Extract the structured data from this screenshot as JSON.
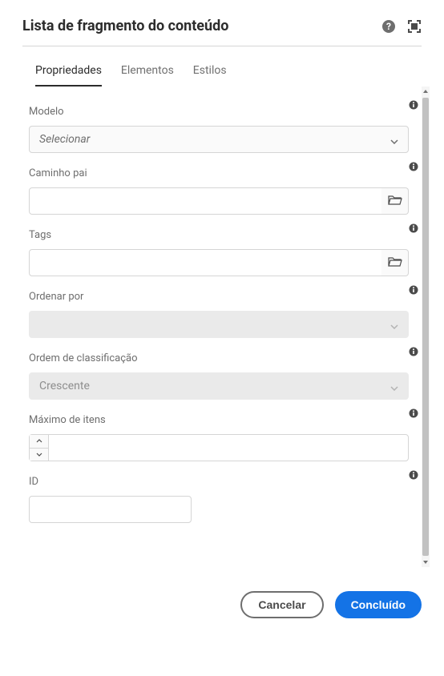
{
  "header": {
    "title": "Lista de fragmento do conteúdo"
  },
  "tabs": {
    "properties": "Propriedades",
    "elements": "Elementos",
    "styles": "Estilos"
  },
  "fields": {
    "model": {
      "label": "Modelo",
      "placeholder": "Selecionar"
    },
    "parentPath": {
      "label": "Caminho pai",
      "value": ""
    },
    "tags": {
      "label": "Tags",
      "value": ""
    },
    "orderBy": {
      "label": "Ordenar por",
      "value": ""
    },
    "sortOrder": {
      "label": "Ordem de classificação",
      "value": "Crescente"
    },
    "maxItems": {
      "label": "Máximo de itens",
      "value": ""
    },
    "id": {
      "label": "ID",
      "value": ""
    }
  },
  "footer": {
    "cancel": "Cancelar",
    "done": "Concluído"
  }
}
